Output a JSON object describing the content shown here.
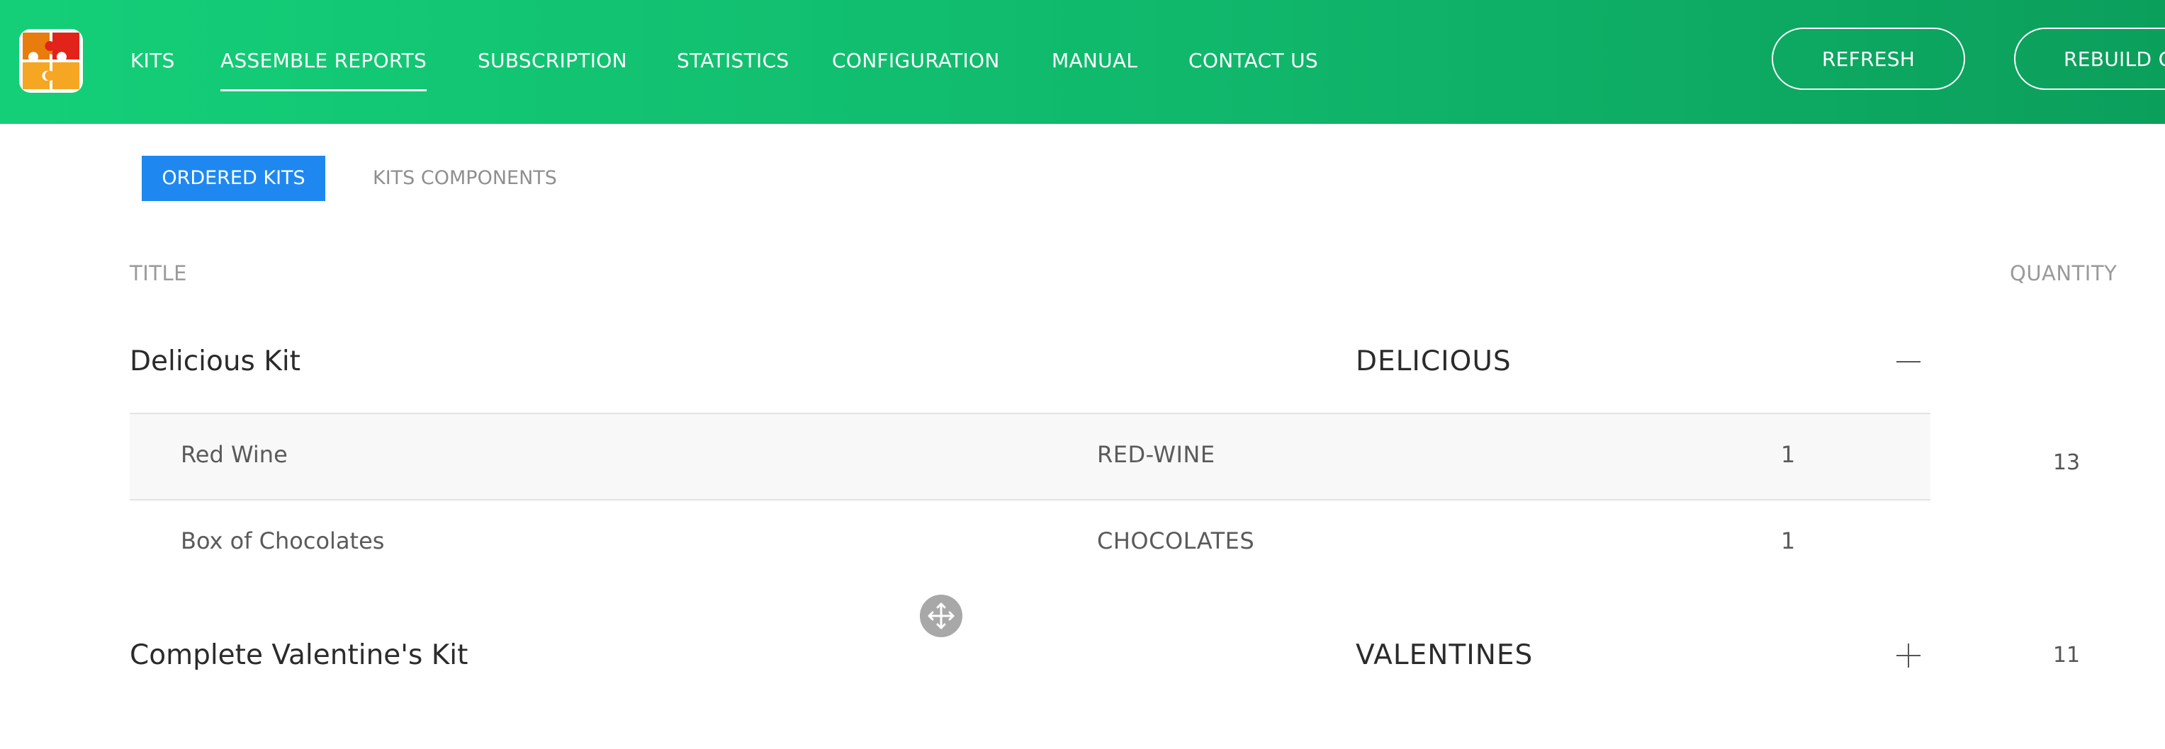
{
  "nav": {
    "items": [
      {
        "label": "KITS",
        "active": false
      },
      {
        "label": "ASSEMBLE REPORTS",
        "active": true
      },
      {
        "label": "SUBSCRIPTION",
        "active": false
      },
      {
        "label": "STATISTICS",
        "active": false
      },
      {
        "label": "CONFIGURATION",
        "active": false
      },
      {
        "label": "MANUAL",
        "active": false
      },
      {
        "label": "CONTACT US",
        "active": false
      }
    ],
    "refresh_label": "REFRESH",
    "rebuild_label": "REBUILD C"
  },
  "tabs": [
    {
      "label": "ORDERED KITS",
      "active": true
    },
    {
      "label": "KITS COMPONENTS",
      "active": false
    }
  ],
  "table": {
    "headers": {
      "title": "TITLE",
      "quantity": "QUANTITY"
    },
    "kits": [
      {
        "title": "Delicious Kit",
        "sku": "DELICIOUS",
        "expanded": true,
        "toggle_icon": "minus-icon",
        "quantity": "13",
        "components": [
          {
            "title": "Red Wine",
            "sku": "RED-WINE",
            "qty": "1"
          },
          {
            "title": "Box of Chocolates",
            "sku": "CHOCOLATES",
            "qty": "1"
          }
        ]
      },
      {
        "title": "Complete Valentine's Kit",
        "sku": "VALENTINES",
        "expanded": false,
        "toggle_icon": "plus-icon",
        "quantity": "11"
      }
    ]
  },
  "colors": {
    "header_start": "#14cf78",
    "header_end": "#0b9f5c",
    "tab_active": "#1e88f0",
    "logo_orange": "#f5a623",
    "logo_dark_orange": "#e87d0d",
    "logo_red": "#e2231a"
  },
  "icons": {
    "logo": "puzzle-logo",
    "drag": "move-arrows-icon"
  }
}
